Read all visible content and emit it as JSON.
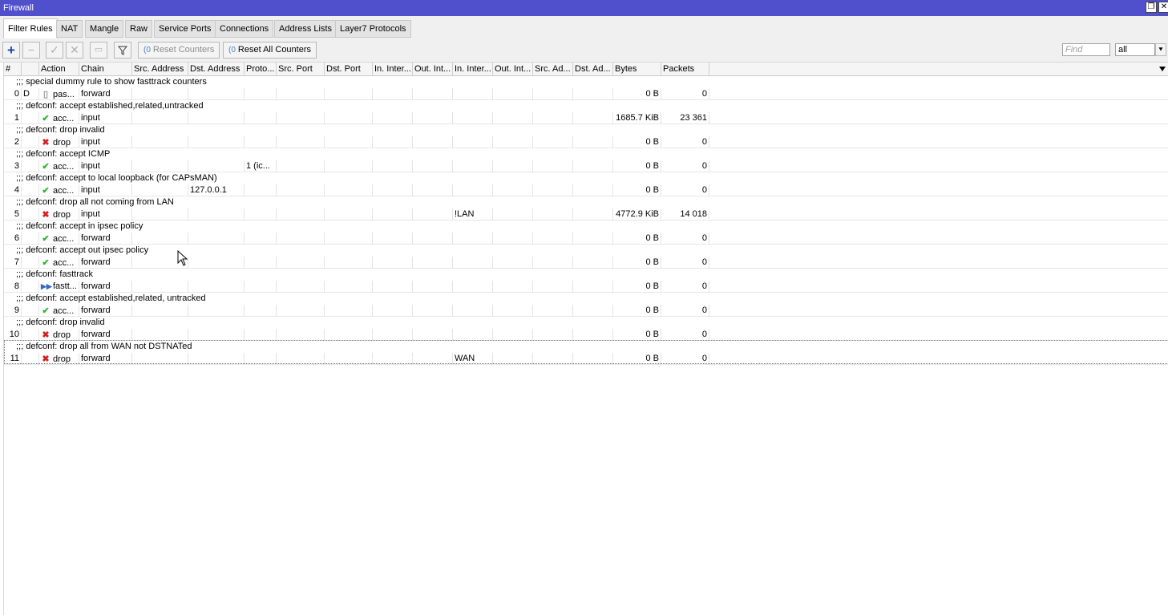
{
  "window": {
    "title": "Firewall",
    "maximize_glyph": "❐",
    "close_glyph": "✕"
  },
  "tabs": [
    "Filter Rules",
    "NAT",
    "Mangle",
    "Raw",
    "Service Ports",
    "Connections",
    "Address Lists",
    "Layer7 Protocols"
  ],
  "toolbar": {
    "icons": [
      "plus-icon",
      "minus-icon",
      "check-icon",
      "cross-icon",
      "comment-icon",
      "filter-icon"
    ],
    "reset_counters": "Reset Counters",
    "reset_all_counters": "Reset All Counters",
    "find_placeholder": "Find",
    "filter_value": "all"
  },
  "columns": [
    "#",
    "",
    "Action",
    "Chain",
    "Src. Address",
    "Dst. Address",
    "Proto...",
    "Src. Port",
    "Dst. Port",
    "In. Inter...",
    "Out. Int...",
    "In. Inter...",
    "Out. Int...",
    "Src. Ad...",
    "Dst. Ad...",
    "Bytes",
    "Packets"
  ],
  "rules": [
    {
      "comment": ";;; special dummy rule to show fasttrack counters",
      "num": "0",
      "flag": "D",
      "action": "pas...",
      "action_icon": "pass-icon",
      "chain": "forward",
      "dst_address": "",
      "protocol": "",
      "in_interface_list": "",
      "bytes": "0 B",
      "packets": "0"
    },
    {
      "comment": ";;; defconf: accept established,related,untracked",
      "num": "1",
      "flag": "",
      "action": "acc...",
      "action_icon": "accept-icon",
      "chain": "input",
      "dst_address": "",
      "protocol": "",
      "in_interface_list": "",
      "bytes": "1685.7 KiB",
      "packets": "23 361"
    },
    {
      "comment": ";;; defconf: drop invalid",
      "num": "2",
      "flag": "",
      "action": "drop",
      "action_icon": "drop-icon",
      "chain": "input",
      "dst_address": "",
      "protocol": "",
      "in_interface_list": "",
      "bytes": "0 B",
      "packets": "0"
    },
    {
      "comment": ";;; defconf: accept ICMP",
      "num": "3",
      "flag": "",
      "action": "acc...",
      "action_icon": "accept-icon",
      "chain": "input",
      "dst_address": "",
      "protocol": "1 (ic...",
      "in_interface_list": "",
      "bytes": "0 B",
      "packets": "0"
    },
    {
      "comment": ";;; defconf: accept to local loopback (for CAPsMAN)",
      "num": "4",
      "flag": "",
      "action": "acc...",
      "action_icon": "accept-icon",
      "chain": "input",
      "dst_address": "127.0.0.1",
      "protocol": "",
      "in_interface_list": "",
      "bytes": "0 B",
      "packets": "0"
    },
    {
      "comment": ";;; defconf: drop all not coming from LAN",
      "num": "5",
      "flag": "",
      "action": "drop",
      "action_icon": "drop-icon",
      "chain": "input",
      "dst_address": "",
      "protocol": "",
      "in_interface_list": "!LAN",
      "bytes": "4772.9 KiB",
      "packets": "14 018"
    },
    {
      "comment": ";;; defconf: accept in ipsec policy",
      "num": "6",
      "flag": "",
      "action": "acc...",
      "action_icon": "accept-icon",
      "chain": "forward",
      "dst_address": "",
      "protocol": "",
      "in_interface_list": "",
      "bytes": "0 B",
      "packets": "0"
    },
    {
      "comment": ";;; defconf: accept out ipsec policy",
      "num": "7",
      "flag": "",
      "action": "acc...",
      "action_icon": "accept-icon",
      "chain": "forward",
      "dst_address": "",
      "protocol": "",
      "in_interface_list": "",
      "bytes": "0 B",
      "packets": "0"
    },
    {
      "comment": ";;; defconf: fasttrack",
      "num": "8",
      "flag": "",
      "action": "fastt...",
      "action_icon": "fasttrack-icon",
      "chain": "forward",
      "dst_address": "",
      "protocol": "",
      "in_interface_list": "",
      "bytes": "0 B",
      "packets": "0"
    },
    {
      "comment": ";;; defconf: accept established,related, untracked",
      "num": "9",
      "flag": "",
      "action": "acc...",
      "action_icon": "accept-icon",
      "chain": "forward",
      "dst_address": "",
      "protocol": "",
      "in_interface_list": "",
      "bytes": "0 B",
      "packets": "0"
    },
    {
      "comment": ";;; defconf: drop invalid",
      "num": "10",
      "flag": "",
      "action": "drop",
      "action_icon": "drop-icon",
      "chain": "forward",
      "dst_address": "",
      "protocol": "",
      "in_interface_list": "",
      "bytes": "0 B",
      "packets": "0"
    },
    {
      "comment": ";;; defconf: drop all from WAN not DSTNATed",
      "num": "11",
      "flag": "",
      "action": "drop",
      "action_icon": "drop-icon",
      "chain": "forward",
      "dst_address": "",
      "protocol": "",
      "in_interface_list": "WAN",
      "bytes": "0 B",
      "packets": "0"
    }
  ],
  "colors": {
    "titlebar": "#5050cc",
    "accept": "#2cb42c",
    "drop": "#d42020",
    "fasttrack": "#3468c4"
  }
}
